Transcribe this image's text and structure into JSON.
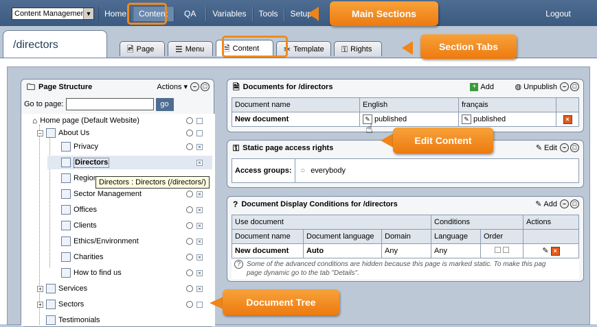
{
  "app_selector": {
    "value": "Content Managemen"
  },
  "nav": {
    "items": [
      "Home",
      "Content",
      "QA",
      "Variables",
      "Tools",
      "Setup"
    ],
    "active": "Content",
    "logout": "Logout"
  },
  "page": {
    "title": "/directors"
  },
  "tabs": [
    {
      "label": "Page",
      "icon": "page-icon"
    },
    {
      "label": "Menu",
      "icon": "menu-icon"
    },
    {
      "label": "Content",
      "icon": "document-icon",
      "active": true
    },
    {
      "label": "Template",
      "icon": "template-icon"
    },
    {
      "label": "Rights",
      "icon": "rights-icon"
    }
  ],
  "page_structure": {
    "title": "Page Structure",
    "actions_label": "Actions",
    "goto_label": "Go to page:",
    "goto_placeholder": "",
    "go_button": "go",
    "tree": [
      {
        "label": "Home page (Default Website)",
        "level": 0
      },
      {
        "label": "About Us",
        "level": 1
      },
      {
        "label": "Privacy",
        "level": 2
      },
      {
        "label": "Directors",
        "level": 2,
        "selected": true
      },
      {
        "label": "Region",
        "level": 2
      },
      {
        "label": "Sector Management",
        "level": 2
      },
      {
        "label": "Offices",
        "level": 2
      },
      {
        "label": "Clients",
        "level": 2
      },
      {
        "label": "Ethics/Environment",
        "level": 2
      },
      {
        "label": "Charities",
        "level": 2
      },
      {
        "label": "How to find us",
        "level": 2
      },
      {
        "label": "Services",
        "level": 1
      },
      {
        "label": "Sectors",
        "level": 1
      },
      {
        "label": "Testimonials",
        "level": 1
      }
    ],
    "tooltip": "Directors : Directors (/directors/)"
  },
  "documents": {
    "title": "Documents for /directors",
    "add_label": "Add",
    "unpublish_label": "Unpublish",
    "columns": [
      "Document name",
      "English",
      "français"
    ],
    "rows": [
      {
        "name": "New document",
        "english": "published",
        "francais": "published"
      }
    ]
  },
  "access_rights": {
    "title": "Static page access rights",
    "edit_label": "Edit",
    "groups_label": "Access groups:",
    "groups_value": "everybody"
  },
  "display_conditions": {
    "title": "Document Display Conditions for /directors",
    "add_label": "Add",
    "group_headers": [
      "Use document",
      "Conditions",
      "Actions"
    ],
    "columns": [
      "Document name",
      "Document language",
      "Domain",
      "Language",
      "Order"
    ],
    "rows": [
      {
        "name": "New document",
        "language": "Auto",
        "domain": "Any",
        "cond_language": "Any"
      }
    ],
    "note_line1": "Some of the advanced conditions are hidden because this page is marked static. To make this pag",
    "note_line2": "page dynamic go to the tab \"Details\"."
  },
  "callouts": {
    "main_sections": "Main Sections",
    "section_tabs": "Section Tabs",
    "edit_content": "Edit Content",
    "document_tree": "Document Tree"
  },
  "colors": {
    "callout": "#ed7a0f",
    "topbar": "#3b5a80",
    "panel_bg": "#bcc8d6"
  }
}
